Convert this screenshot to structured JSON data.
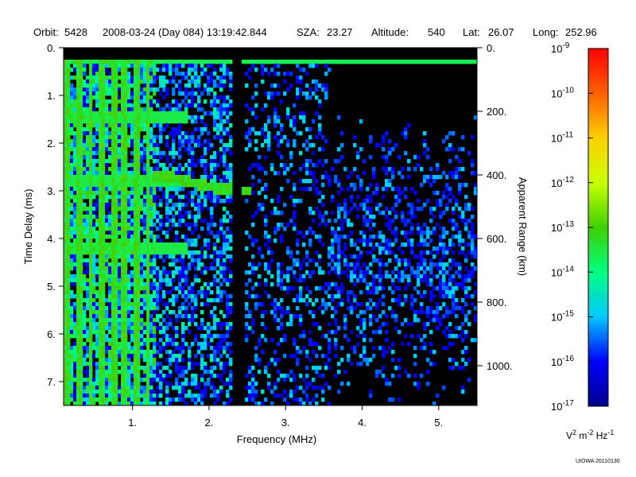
{
  "header": {
    "orbit_label": "Orbit:",
    "orbit": "5428",
    "datetime": "2008-03-24 (Day 084) 13:19:42.844",
    "sza_label": "SZA:",
    "sza": "23.27",
    "altitude_label": "Altitude:",
    "altitude": "540",
    "lat_label": "Lat:",
    "lat": "26.07",
    "long_label": "Long:",
    "long": "252.96"
  },
  "credit": "UIOWA 20110130",
  "chart_data": {
    "type": "heatmap",
    "xlabel": "Frequency (MHz)",
    "ylabel": "Time Delay (ms)",
    "y2label": "Apparent Range (km)",
    "xlim": [
      0.1,
      5.5
    ],
    "ylim": [
      0,
      7.5
    ],
    "y_inverted": true,
    "y2lim": [
      0,
      1125
    ],
    "x_ticks": [
      {
        "value": 1,
        "label": "1."
      },
      {
        "value": 2,
        "label": "2."
      },
      {
        "value": 3,
        "label": "3."
      },
      {
        "value": 4,
        "label": "4."
      },
      {
        "value": 5,
        "label": "5."
      }
    ],
    "y_ticks": [
      {
        "value": 0,
        "label": "0."
      },
      {
        "value": 1,
        "label": "1."
      },
      {
        "value": 2,
        "label": "2."
      },
      {
        "value": 3,
        "label": "3."
      },
      {
        "value": 4,
        "label": "4."
      },
      {
        "value": 5,
        "label": "5."
      },
      {
        "value": 6,
        "label": "6."
      },
      {
        "value": 7,
        "label": "7."
      }
    ],
    "y2_ticks": [
      {
        "value": 0,
        "label": "0."
      },
      {
        "value": 200,
        "label": "200."
      },
      {
        "value": 400,
        "label": "400."
      },
      {
        "value": 600,
        "label": "600."
      },
      {
        "value": 800,
        "label": "800."
      },
      {
        "value": 1000,
        "label": "1000."
      }
    ],
    "colorbar": {
      "scale": "log",
      "min_exp": -17,
      "max_exp": -9,
      "base_label": "10",
      "tick_exponents": [
        -9,
        -10,
        -11,
        -12,
        -13,
        -14,
        -15,
        -16,
        -17
      ],
      "tick_exp_labels": [
        "-9",
        "-10",
        "-11",
        "-12",
        "-13",
        "-14",
        "-15",
        "-16",
        "-17"
      ],
      "unit_V": "V",
      "unit_V_exp": "2",
      "unit_m": " m",
      "unit_m_exp": "-2",
      "unit_Hz": " Hz",
      "unit_Hz_exp": "-1",
      "colors": [
        "#00008b",
        "#0000ff",
        "#00c8ff",
        "#00ff80",
        "#40d000",
        "#c8ff00",
        "#ffd000",
        "#ff6000",
        "#ff0000"
      ]
    },
    "background_color": "#000000",
    "features": {
      "ground_echo_delay_ms": 0.25,
      "local_plasma_harmonics_mhz": [
        0.15,
        0.3,
        0.45,
        0.6,
        0.75,
        0.9,
        1.05,
        1.2
      ],
      "cyclotron_echo_delays_ms": [
        1.45,
        2.8,
        4.2
      ],
      "ionospheric_trace": [
        {
          "f": 1.25,
          "d": 2.7
        },
        {
          "f": 1.5,
          "d": 2.72
        },
        {
          "f": 1.7,
          "d": 2.78
        },
        {
          "f": 1.9,
          "d": 2.88
        },
        {
          "f": 2.1,
          "d": 2.96
        },
        {
          "f": 2.25,
          "d": 2.98
        },
        {
          "f": 2.5,
          "d": 3.0
        },
        {
          "f": 2.55,
          "d": 3.02
        },
        {
          "f": 3.15,
          "d": 3.25
        }
      ],
      "gap_mhz": [
        2.3,
        2.42
      ],
      "noise_regions": [
        {
          "f0": 0.1,
          "f1": 1.3,
          "density": 0.8,
          "level": 0.45
        },
        {
          "f0": 1.3,
          "f1": 2.3,
          "density": 0.55,
          "level": 0.3
        },
        {
          "f0": 2.45,
          "f1": 3.6,
          "density": 0.28,
          "level": 0.25
        },
        {
          "f0": 3.6,
          "f1": 5.5,
          "density": 0.55,
          "level": 0.22
        }
      ]
    }
  }
}
